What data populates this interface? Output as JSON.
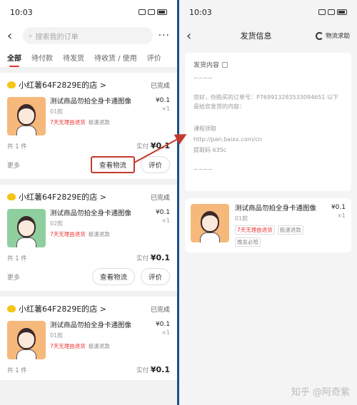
{
  "left": {
    "time": "10:03",
    "search_placeholder": "搜索我的订单",
    "more": "···",
    "tabs": [
      "全部",
      "待付款",
      "待发货",
      "待收货 / 使用",
      "评价"
    ],
    "orders": [
      {
        "shop": "小红薯64F2829E的店 >",
        "state": "已完成",
        "title": "测试商品勿拍全身卡通图像",
        "spec": "01款",
        "price": "¥0.1",
        "qty": "×1",
        "tag1": "7天无理由退货",
        "tag2": "极速退款",
        "count": "共 1 件",
        "paid_label": "实付",
        "paid": "¥0.1",
        "more": "更多",
        "logistics": "查看物流",
        "review": "评价",
        "thumb": "orange"
      },
      {
        "shop": "小红薯64F2829E的店 >",
        "state": "已完成",
        "title": "测试商品勿拍全身卡通图像",
        "spec": "02款",
        "price": "¥0.1",
        "qty": "×1",
        "tag1": "7天无理由退货",
        "tag2": "极速退款",
        "count": "共 1 件",
        "paid_label": "实付",
        "paid": "¥0.1",
        "more": "更多",
        "logistics": "查看物流",
        "review": "评价",
        "thumb": "green"
      },
      {
        "shop": "小红薯64F2829E的店 >",
        "state": "已完成",
        "title": "测试商品勿拍全身卡通图像",
        "spec": "01款",
        "price": "¥0.1",
        "qty": "×1",
        "tag1": "7天无理由退货",
        "tag2": "极速退款",
        "count": "共 1 件",
        "paid_label": "实付",
        "paid": "¥0.1",
        "thumb": "orange"
      }
    ]
  },
  "right": {
    "time": "10:03",
    "title": "发货信息",
    "help": "物流求助",
    "content_label": "发货内容",
    "dashes1": "~~~~",
    "msg": "您好，你购买的订单号：P769913283533094651 以下是给您发货的内容：",
    "course": "课程领取",
    "url": "http://pan.baixx.com/cn",
    "code": "提取码 635c",
    "dashes2": "~~~~",
    "prod_title": "测试商品勿拍全身卡通图像",
    "prod_spec": "01款",
    "prod_price": "¥0.1",
    "prod_qty": "×1",
    "tag1": "7天无理由退货",
    "tag2": "极速退款",
    "tag3": "晚发必赔"
  },
  "watermark": "知乎 @阿奇紫"
}
